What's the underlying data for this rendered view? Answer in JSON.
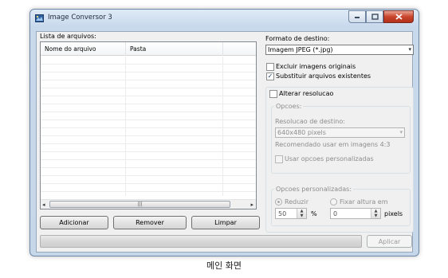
{
  "window": {
    "title": "Image Conversor 3",
    "icon": "app-icon",
    "controls": {
      "minimize": "minimize-icon",
      "maximize": "maximize-icon",
      "close": "close-icon"
    }
  },
  "files": {
    "label": "Lista de arquivos:",
    "columns": [
      "Nome do arquivo",
      "Pasta"
    ],
    "scroll_left": "◂",
    "scroll_right": "▸",
    "scroll_grip": "|||"
  },
  "buttons": {
    "add": "Adicionar",
    "remove": "Remover",
    "clear": "Limpar",
    "apply": "Aplicar"
  },
  "output": {
    "format_label": "Formato de destino:",
    "format_value": "Imagem JPEG (*.jpg)",
    "delete_originals": {
      "label": "Excluir imagens originais",
      "checked": false
    },
    "replace_existing": {
      "label": "Substituir arquivos existentes",
      "checked": true
    },
    "check_mark": "✓"
  },
  "resize": {
    "toggle_label": "Alterar resolucao",
    "options_label": "Opcoes:",
    "target_label": "Resolucao de destino:",
    "target_value": "640x480 pixels",
    "recommendation": "Recomendado usar em imagens 4:3",
    "use_custom_label": "Usar opcoes personalizadas"
  },
  "custom": {
    "group_label": "Opcoes personalizadas:",
    "reduce_label": "Reduzir",
    "reduce_value": "50",
    "reduce_unit": "%",
    "fixed_height_label": "Fixar altura em",
    "fixed_height_value": "0",
    "fixed_height_unit": "pixels",
    "spin_up": "▲",
    "spin_down": "▼"
  },
  "dropdown_arrow": "▾",
  "caption": "메인 화면"
}
